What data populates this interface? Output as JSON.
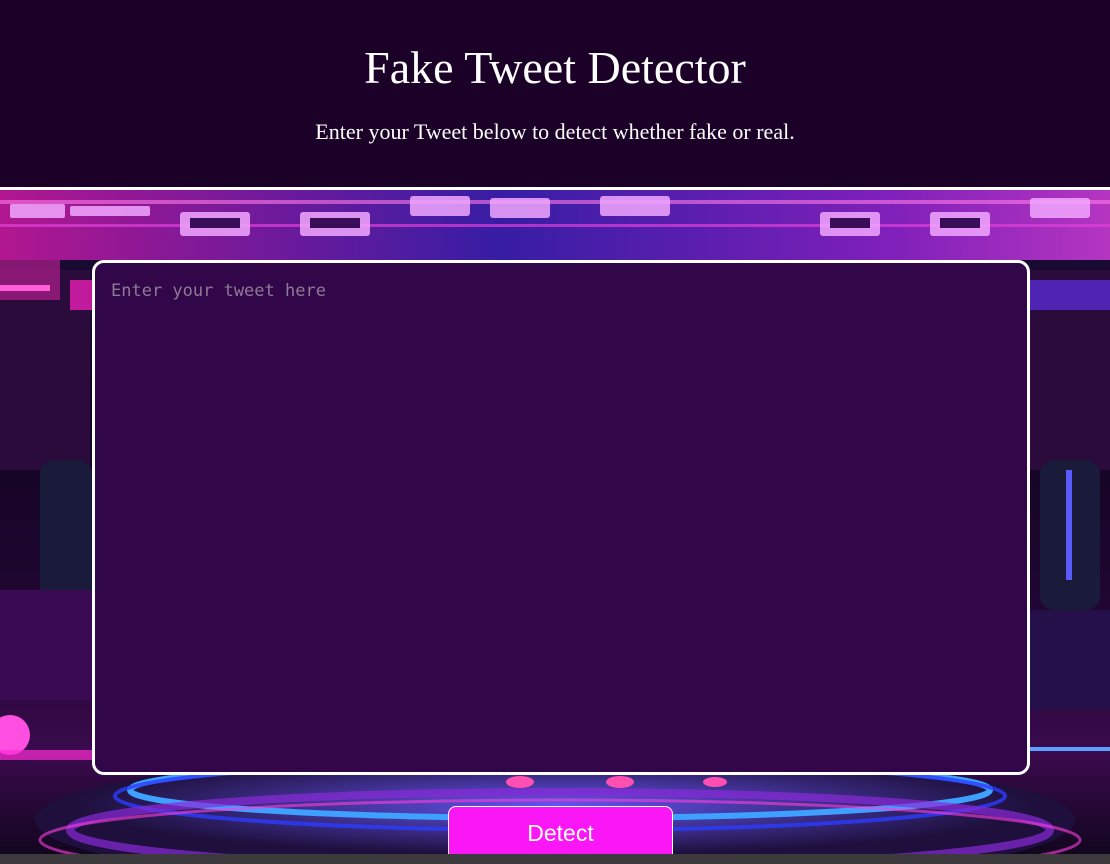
{
  "header": {
    "title": "Fake Tweet Detector",
    "subtitle": "Enter your Tweet below to detect whether fake or real."
  },
  "form": {
    "tweet_placeholder": "Enter your tweet here",
    "tweet_value": "",
    "detect_label": "Detect"
  },
  "colors": {
    "header_bg": "#1b0127",
    "input_bg": "#310749",
    "button_bg": "#fb17f5",
    "neon_pink": "#ff2bd6",
    "neon_blue": "#3a5bff"
  }
}
